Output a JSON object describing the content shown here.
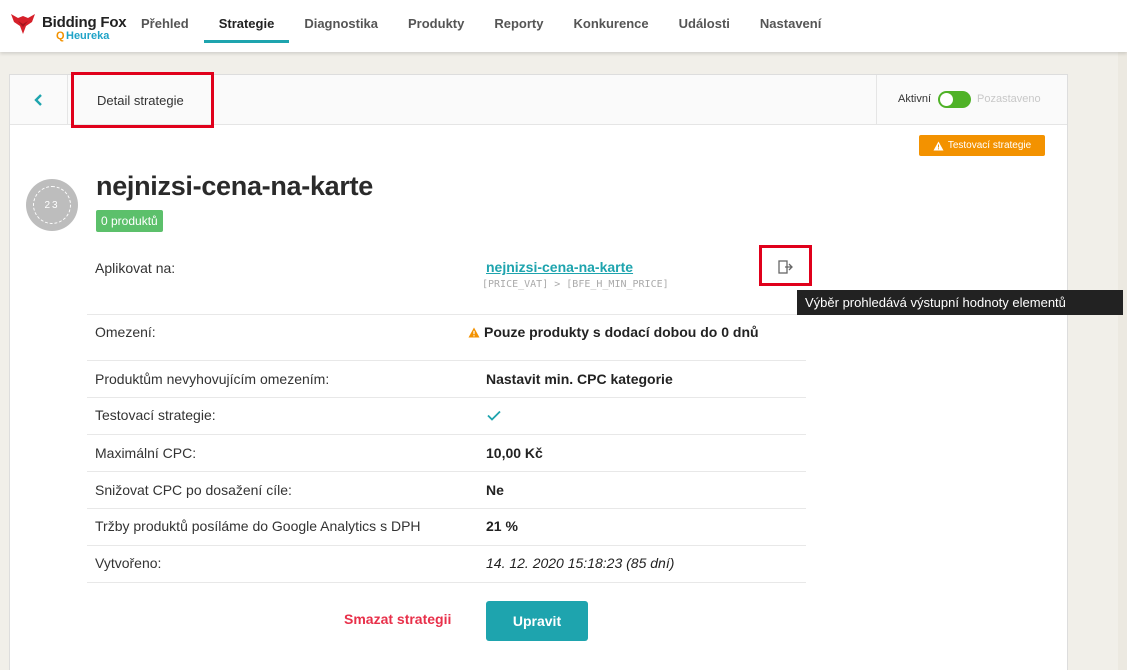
{
  "app": {
    "logo_title": "Bidding Fox",
    "logo_sub": "Heureka"
  },
  "nav": {
    "items": [
      {
        "label": "Přehled"
      },
      {
        "label": "Strategie"
      },
      {
        "label": "Diagnostika"
      },
      {
        "label": "Produkty"
      },
      {
        "label": "Reporty"
      },
      {
        "label": "Konkurence"
      },
      {
        "label": "Události"
      },
      {
        "label": "Nastavení"
      }
    ],
    "active": "Strategie"
  },
  "header": {
    "title": "Detail strategie",
    "toggle_on": "Aktivní",
    "toggle_off": "Pozastaveno",
    "active": true
  },
  "strategy": {
    "test_badge": "Testovací strategie",
    "avatar_text": "23",
    "name": "nejnizsi-cena-na-karte",
    "products_badge": "0 produktů"
  },
  "rows": {
    "apply_label": "Aplikovat na:",
    "apply_link": "nejnizsi-cena-na-karte",
    "apply_code": "[PRICE_VAT] > [BFE_H_MIN_PRICE]",
    "restriction_label": "Omezení:",
    "restriction_value": "Pouze produkty s dodací dobou do 0 dnů",
    "nonmatching_label": "Produktům nevyhovujícím omezením:",
    "nonmatching_value": "Nastavit min. CPC kategorie",
    "test_label": "Testovací strategie:",
    "maxcpc_label": "Maximální CPC:",
    "maxcpc_value": "10,00 Kč",
    "lower_label": "Snižovat CPC po dosažení cíle:",
    "lower_value": "Ne",
    "ga_label": "Tržby produktů posíláme do Google Analytics s DPH",
    "ga_value": "21 %",
    "created_label": "Vytvořeno:",
    "created_value": "14. 12. 2020 15:18:23 (85 dní)"
  },
  "tooltip": "Výběr prohledává výstupní hodnoty elementů",
  "actions": {
    "delete_label": "Smazat strategii",
    "edit_label": "Upravit"
  },
  "colors": {
    "accent": "#1ea4ae",
    "warning": "#f39200",
    "danger": "#e8304a",
    "success": "#5cc06b"
  }
}
